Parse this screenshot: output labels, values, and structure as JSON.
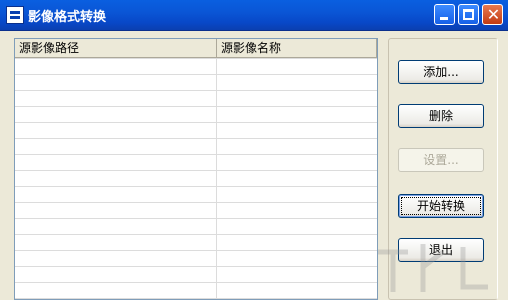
{
  "window": {
    "title": "影像格式转换",
    "app_icon": "app-window-icon",
    "controls": {
      "minimize": "minimize-icon",
      "maximize": "maximize-icon",
      "close": "close-icon",
      "close_glyph": "✕"
    }
  },
  "list": {
    "columns": [
      "源影像路径",
      "源影像名称"
    ],
    "rows": []
  },
  "buttons": {
    "add": "添加...",
    "delete": "删除",
    "settings": "设置...",
    "start": "开始转换",
    "exit": "退出"
  }
}
